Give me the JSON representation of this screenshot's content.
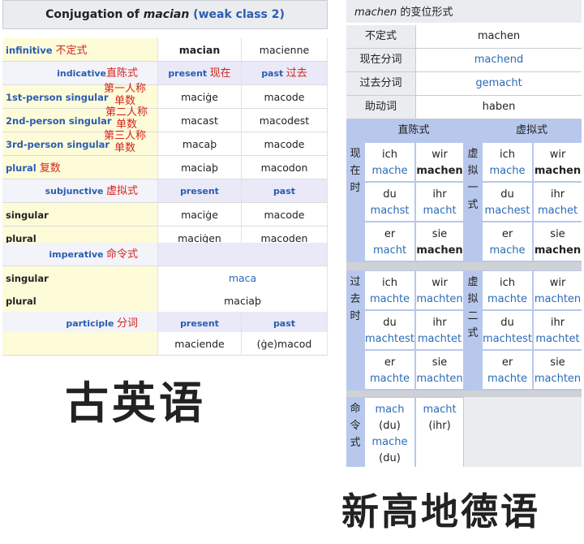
{
  "old_english": {
    "title_prefix": "Conjugation of ",
    "title_verb": "macian",
    "title_class": " (weak class 2)",
    "rows": [
      {
        "type": "data",
        "label": "infinitive",
        "zh": "不定式",
        "v1": "macian",
        "v2": "macienne"
      },
      {
        "type": "hdr",
        "label": "indicative",
        "zh": "直陈式",
        "v1": "present",
        "v1_zh": "现在",
        "v2": "past",
        "v2_zh": "过去"
      },
      {
        "type": "data",
        "label": "1st-person singular",
        "zh": "第一人称单数",
        "v1": "maciġe",
        "v2": "macode"
      },
      {
        "type": "data",
        "label": "2nd-person singular",
        "zh": "第二人称单数",
        "v1": "macast",
        "v2": "macodest"
      },
      {
        "type": "data",
        "label": "3rd-person singular",
        "zh": "第三人称单数",
        "v1": "macaþ",
        "v2": "macode"
      },
      {
        "type": "data",
        "label": "plural",
        "zh": "复数",
        "v1": "maciaþ",
        "v2": "macodon"
      },
      {
        "type": "hdr",
        "label": "subjunctive",
        "zh": "虚拟式",
        "v1": "present",
        "v2": "past"
      },
      {
        "type": "data",
        "label": "singular",
        "v1": "maciġe",
        "v2": "macode"
      },
      {
        "type": "data",
        "label": "plural",
        "v1": "maciġen",
        "v2": "macoden"
      },
      {
        "type": "hdr1",
        "label": "imperative",
        "zh": "命令式"
      },
      {
        "type": "span",
        "label": "singular",
        "v": "maca"
      },
      {
        "type": "span",
        "label": "plural",
        "v": "maciaþ"
      },
      {
        "type": "hdr",
        "label": "participle",
        "zh": "分词",
        "v1": "present",
        "v2": "past"
      },
      {
        "type": "data",
        "label": "",
        "v1": "maciende",
        "v2": "(ġe)macod"
      }
    ],
    "caption": "古英语"
  },
  "german": {
    "title_verb": "machen",
    "title_suffix": " 的变位形式",
    "basics": [
      {
        "k": "不定式",
        "v": "machen",
        "link": false
      },
      {
        "k": "现在分词",
        "v": "machend",
        "link": true
      },
      {
        "k": "过去分词",
        "v": "gemacht",
        "link": true
      },
      {
        "k": "助动词",
        "v": "haben",
        "link": false
      }
    ],
    "mood_ind": "直陈式",
    "mood_subj": "虚拟式",
    "present_label": "现在时",
    "subj1_label": "虚拟一式",
    "past_label": "过去时",
    "subj2_label": "虚拟二式",
    "imperative_label": "命令式",
    "present": [
      [
        "ich",
        "mache"
      ],
      [
        "wir",
        "machen"
      ],
      [
        "du",
        "machst"
      ],
      [
        "ihr",
        "macht"
      ],
      [
        "er",
        "macht"
      ],
      [
        "sie",
        "machen"
      ]
    ],
    "subj1": [
      [
        "ich",
        "mache"
      ],
      [
        "wir",
        "machen"
      ],
      [
        "du",
        "machest"
      ],
      [
        "ihr",
        "machet"
      ],
      [
        "er",
        "mache"
      ],
      [
        "sie",
        "machen"
      ]
    ],
    "past": [
      [
        "ich",
        "machte"
      ],
      [
        "wir",
        "machten"
      ],
      [
        "du",
        "machtest"
      ],
      [
        "ihr",
        "machtet"
      ],
      [
        "er",
        "machte"
      ],
      [
        "sie",
        "machten"
      ]
    ],
    "subj2": [
      [
        "ich",
        "machte"
      ],
      [
        "wir",
        "machten"
      ],
      [
        "du",
        "machtest"
      ],
      [
        "ihr",
        "machtet"
      ],
      [
        "er",
        "machte"
      ],
      [
        "sie",
        "machten"
      ]
    ],
    "imp_du_1": "mach",
    "imp_du_1_p": "(du)",
    "imp_du_2": "mache",
    "imp_du_2_p": "(du)",
    "imp_ihr": "macht",
    "imp_ihr_p": "(ihr)",
    "caption": "新高地德语"
  }
}
